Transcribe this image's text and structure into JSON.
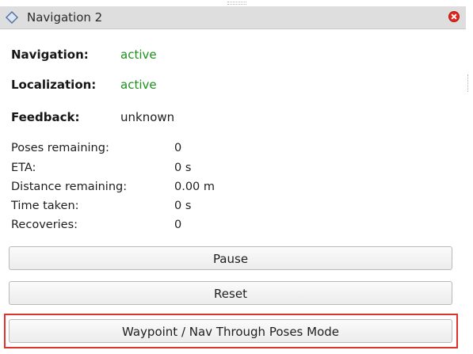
{
  "window": {
    "title": "Navigation 2",
    "title_icon": "diamond-icon",
    "close_icon": "close-icon"
  },
  "status": {
    "navigation_label": "Navigation:",
    "navigation_value": "active",
    "localization_label": "Localization:",
    "localization_value": "active",
    "feedback_label": "Feedback:",
    "feedback_value": "unknown"
  },
  "stats": [
    {
      "label": "Poses remaining:",
      "value": "0"
    },
    {
      "label": "ETA:",
      "value": "0 s"
    },
    {
      "label": "Distance remaining:",
      "value": "0.00 m"
    },
    {
      "label": "Time taken:",
      "value": "0 s"
    },
    {
      "label": "Recoveries:",
      "value": "0"
    }
  ],
  "buttons": {
    "pause": "Pause",
    "reset": "Reset",
    "waypoint_mode": "Waypoint / Nav Through Poses Mode"
  },
  "colors": {
    "active": "#1c8f1c",
    "highlight": "#e3322b",
    "close": "#e0261f",
    "titlebar": "#dedede"
  }
}
